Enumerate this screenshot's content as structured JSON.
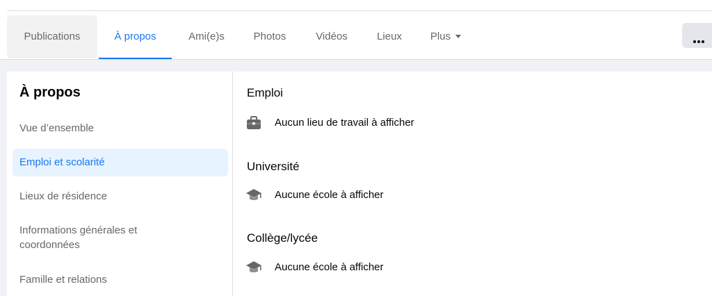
{
  "tabs": [
    {
      "label": "Publications",
      "active": false
    },
    {
      "label": "À propos",
      "active": true
    },
    {
      "label": "Ami(e)s",
      "active": false
    },
    {
      "label": "Photos",
      "active": false
    },
    {
      "label": "Vidéos",
      "active": false
    },
    {
      "label": "Lieux",
      "active": false
    },
    {
      "label": "Plus",
      "active": false
    }
  ],
  "more_button_icon": "more-horizontal-icon",
  "sidebar": {
    "title": "À propos",
    "items": [
      {
        "label": "Vue d’ensemble",
        "selected": false
      },
      {
        "label": "Emploi et scolarité",
        "selected": true
      },
      {
        "label": "Lieux de résidence",
        "selected": false
      },
      {
        "label": "Informations générales et coordonnées",
        "selected": false
      },
      {
        "label": "Famille et relations",
        "selected": false
      }
    ]
  },
  "content": {
    "work": {
      "title": "Emploi",
      "empty_text": "Aucun lieu de travail à afficher",
      "icon": "briefcase-icon"
    },
    "university": {
      "title": "Université",
      "empty_text": "Aucune école à afficher",
      "icon": "graduation-cap-icon"
    },
    "high_school": {
      "title": "Collège/lycée",
      "empty_text": "Aucune école à afficher",
      "icon": "graduation-cap-icon"
    }
  },
  "colors": {
    "accent": "#1877f2",
    "selected_bg": "#e7f3ff",
    "secondary_text": "#65676b",
    "page_bg": "#f0f2f5"
  }
}
